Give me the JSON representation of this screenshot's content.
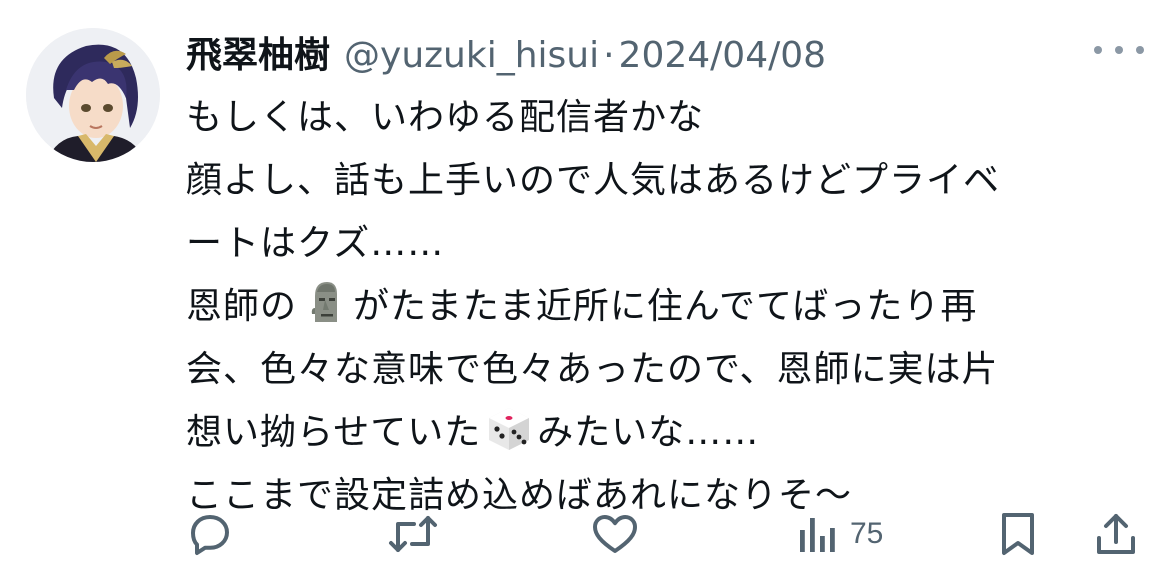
{
  "tweet": {
    "display_name": "飛翠柚樹",
    "handle": "@yuzuki_hisui",
    "separator": "·",
    "date": "2024/04/08",
    "lines": [
      "もしくは、いわゆる配信者かな",
      "顔よし、話も上手いので人気はあるけどプライベ",
      "ートはクズ……",
      "恩師の",
      "がたまたま近所に住んでてばったり再",
      "会、色々な意味で色々あったので、恩師に実は片",
      "想い拗らせていた",
      "みたいな……",
      "ここまで設定詰め込めばあれになりそ〜"
    ],
    "emojis": {
      "moai": "moai-emoji",
      "dice": "dice-emoji"
    },
    "metrics": {
      "views": "75"
    },
    "icons": {
      "reply": "reply-icon",
      "retweet": "retweet-icon",
      "like": "like-icon",
      "views": "views-icon",
      "bookmark": "bookmark-icon",
      "share": "share-icon",
      "more": "more-icon"
    },
    "colors": {
      "text": "#0f1419",
      "secondary": "#536471",
      "background": "#ffffff"
    }
  }
}
